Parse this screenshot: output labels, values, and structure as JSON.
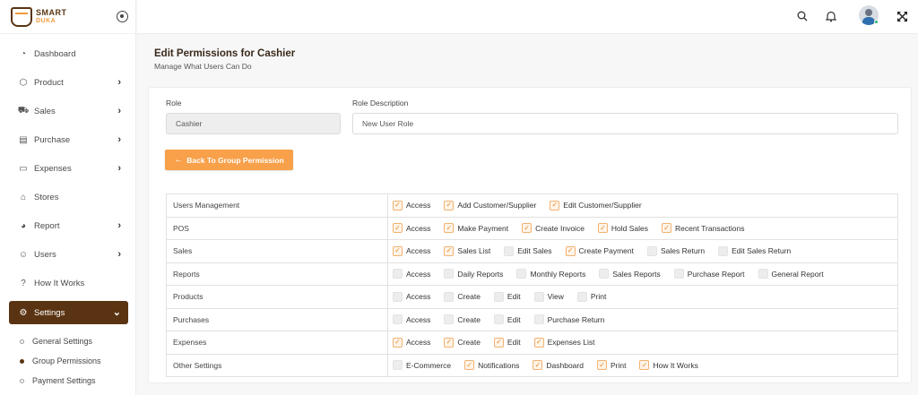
{
  "brand": {
    "line1": "SMART",
    "line2": "DUKA"
  },
  "sidebar": {
    "items": [
      {
        "label": "Dashboard",
        "icon": "gauge-icon",
        "glyph": "◔",
        "chevron": false
      },
      {
        "label": "Product",
        "icon": "box-icon",
        "glyph": "⬡",
        "chevron": true
      },
      {
        "label": "Sales",
        "icon": "cart-icon",
        "glyph": "⛟",
        "chevron": true
      },
      {
        "label": "Purchase",
        "icon": "receipt-icon",
        "glyph": "▤",
        "chevron": true
      },
      {
        "label": "Expenses",
        "icon": "wallet-icon",
        "glyph": "▭",
        "chevron": true
      },
      {
        "label": "Stores",
        "icon": "home-icon",
        "glyph": "⌂",
        "chevron": false
      },
      {
        "label": "Report",
        "icon": "pie-chart-icon",
        "glyph": "◕",
        "chevron": true
      },
      {
        "label": "Users",
        "icon": "user-icon",
        "glyph": "☺",
        "chevron": true
      },
      {
        "label": "How It Works",
        "icon": "help-icon",
        "glyph": "?",
        "chevron": false
      }
    ],
    "active": {
      "label": "Settings",
      "icon": "gear-icon",
      "glyph": "⚙"
    },
    "subitems": [
      {
        "label": "General Settings",
        "current": false
      },
      {
        "label": "Group Permissions",
        "current": true
      },
      {
        "label": "Payment Settings",
        "current": false
      }
    ]
  },
  "header": {
    "icons": [
      "search-icon",
      "bell-icon",
      "avatar",
      "fullscreen-icon"
    ]
  },
  "page": {
    "title": "Edit Permissions for Cashier",
    "subtitle": "Manage What Users Can Do"
  },
  "form": {
    "role_label": "Role",
    "role_value": "Cashier",
    "desc_label": "Role Description",
    "desc_value": "New User Role",
    "back_button": "Back To Group Permission"
  },
  "permissions": [
    {
      "module": "Users Management",
      "perms": [
        [
          "Access",
          true
        ],
        [
          "Add Customer/Supplier",
          true
        ],
        [
          "Edit Customer/Supplier",
          true
        ]
      ]
    },
    {
      "module": "POS",
      "perms": [
        [
          "Access",
          true
        ],
        [
          "Make Payment",
          true
        ],
        [
          "Create Invoice",
          true
        ],
        [
          "Hold Sales",
          true
        ],
        [
          "Recent Transactions",
          true
        ]
      ]
    },
    {
      "module": "Sales",
      "perms": [
        [
          "Access",
          true
        ],
        [
          "Sales List",
          true
        ],
        [
          "Edit Sales",
          false
        ],
        [
          "Create Payment",
          true
        ],
        [
          "Sales Return",
          false
        ],
        [
          "Edit Sales Return",
          false
        ]
      ]
    },
    {
      "module": "Reports",
      "perms": [
        [
          "Access",
          false
        ],
        [
          "Daily Reports",
          false
        ],
        [
          "Monthly Reports",
          false
        ],
        [
          "Sales Reports",
          false
        ],
        [
          "Purchase Report",
          false
        ],
        [
          "General Report",
          false
        ]
      ]
    },
    {
      "module": "Products",
      "perms": [
        [
          "Access",
          false
        ],
        [
          "Create",
          false
        ],
        [
          "Edit",
          false
        ],
        [
          "View",
          false
        ],
        [
          "Print",
          false
        ]
      ]
    },
    {
      "module": "Purchases",
      "perms": [
        [
          "Access",
          false
        ],
        [
          "Create",
          false
        ],
        [
          "Edit",
          false
        ],
        [
          "Purchase Return",
          false
        ]
      ]
    },
    {
      "module": "Expenses",
      "perms": [
        [
          "Access",
          true
        ],
        [
          "Create",
          true
        ],
        [
          "Edit",
          true
        ],
        [
          "Expenses List",
          true
        ]
      ]
    },
    {
      "module": "Other Settings",
      "perms": [
        [
          "E-Commerce",
          false
        ],
        [
          "Notifications",
          true
        ],
        [
          "Dashboard",
          true
        ],
        [
          "Print",
          true
        ],
        [
          "How It Works",
          true
        ]
      ]
    }
  ],
  "colors": {
    "brand_brown": "#5a3412",
    "accent_orange": "#f8a04a"
  }
}
